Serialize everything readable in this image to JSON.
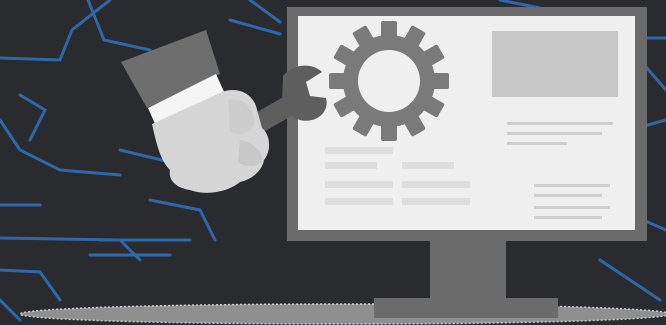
{
  "scene": {
    "background_color": "#2a2b2e",
    "circuit_color": "#2f6fb8",
    "monitor_frame_color": "#6b6b6b",
    "screen_color": "#efefef",
    "gear_color": "#7a7a7a",
    "wrench_color": "#5e5e5e",
    "glove_color": "#d6d6d6",
    "sleeve_color": "#6e6e6e",
    "icons": [
      "gear-icon",
      "wrench-icon",
      "glove-hand-icon",
      "monitor-icon"
    ]
  }
}
